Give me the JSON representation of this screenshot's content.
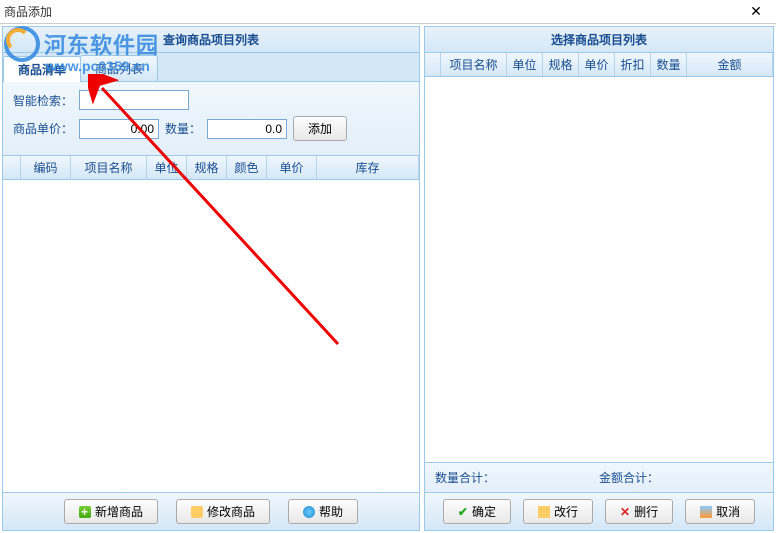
{
  "window": {
    "title": "商品添加"
  },
  "watermark": {
    "text": "河东软件园",
    "url": "www.pc0359.cn"
  },
  "left": {
    "header": "查询商品项目列表",
    "tabs": {
      "active": "商品清单",
      "inactive": "商品列表"
    },
    "form": {
      "search_label": "智能检索：",
      "search_value": "",
      "price_label": "商品单价：",
      "price_value": "0.00",
      "qty_label": "数量：",
      "qty_value": "0.0",
      "add_btn": "添加"
    },
    "columns": [
      "编码",
      "项目名称",
      "单位",
      "规格",
      "颜色",
      "单价",
      "库存"
    ],
    "footer": {
      "new": "新增商品",
      "modify": "修改商品",
      "help": "帮助"
    }
  },
  "right": {
    "header": "选择商品项目列表",
    "columns": [
      "项目名称",
      "单位",
      "规格",
      "单价",
      "折扣",
      "数量",
      "金额"
    ],
    "summary": {
      "qty": "数量合计：",
      "amount": "金额合计："
    },
    "footer": {
      "ok": "确定",
      "edit": "改行",
      "del": "删行",
      "cancel": "取消"
    }
  }
}
